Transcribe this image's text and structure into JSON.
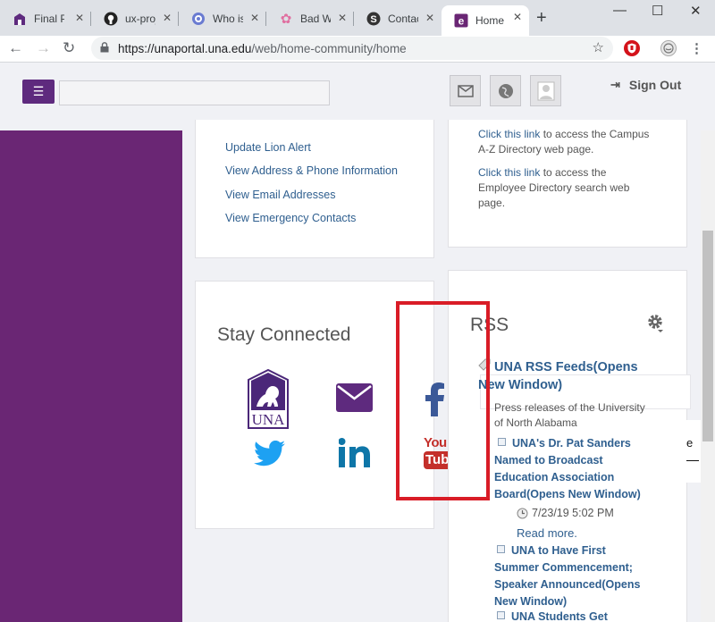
{
  "browser": {
    "tabs": [
      {
        "title": "Final Pr",
        "icon": "una-icon"
      },
      {
        "title": "ux-proj",
        "icon": "github-icon"
      },
      {
        "title": "Who is",
        "icon": "chat-icon"
      },
      {
        "title": "Bad We",
        "icon": "flower-icon"
      },
      {
        "title": "Contact",
        "icon": "s-logo-icon"
      },
      {
        "title": "Home",
        "icon": "e-logo-icon"
      }
    ],
    "url_host": "https://unaportal.una.edu",
    "url_path": "/web/home-community/home"
  },
  "header": {
    "sign_out": "Sign Out"
  },
  "personal_links": [
    "Update Lion Alert",
    "View Address & Phone Information",
    "View Email Addresses",
    "View Emergency Contacts"
  ],
  "directory": {
    "p1_link": "Click this link",
    "p1_line1": " to access the Campus",
    "p1_line2": "A-Z Directory web page.",
    "p2_link": "Click this link",
    "p2_line1": " to access the",
    "p2_line2": "Employee Directory search web",
    "p2_line3": "page."
  },
  "stay_connected": {
    "title": "Stay Connected",
    "una_logo_text": "UNA",
    "youtube_top": "You",
    "youtube_bottom": "Tube"
  },
  "rss": {
    "title": "RSS",
    "feed_title_line1": "UNA RSS Feeds(Opens",
    "feed_title_line2": "New Window)",
    "desc_line1": "Press releases of the University",
    "desc_line2": "of North Alabama",
    "item1_lines": [
      "UNA's Dr. Pat Sanders",
      "Named to Broadcast",
      "Education Association",
      "Board(Opens New Window)"
    ],
    "item1_date": "7/23/19 5:02 PM",
    "read_more": "Read more.",
    "item2_lines": [
      "UNA to Have First",
      "Summer Commencement;",
      "Speaker Announced(Opens",
      "New Window)"
    ],
    "item3_line": "UNA Students Get"
  },
  "colors": {
    "brand_purple": "#5e2a7e",
    "sidebar_purple": "#6a2674",
    "link_blue": "#2f5f8f",
    "highlight_red": "#d91c26",
    "facebook_blue": "#3b5998",
    "twitter_blue": "#1da1f2",
    "linkedin_blue": "#0e76a8",
    "youtube_red": "#c4302b"
  }
}
